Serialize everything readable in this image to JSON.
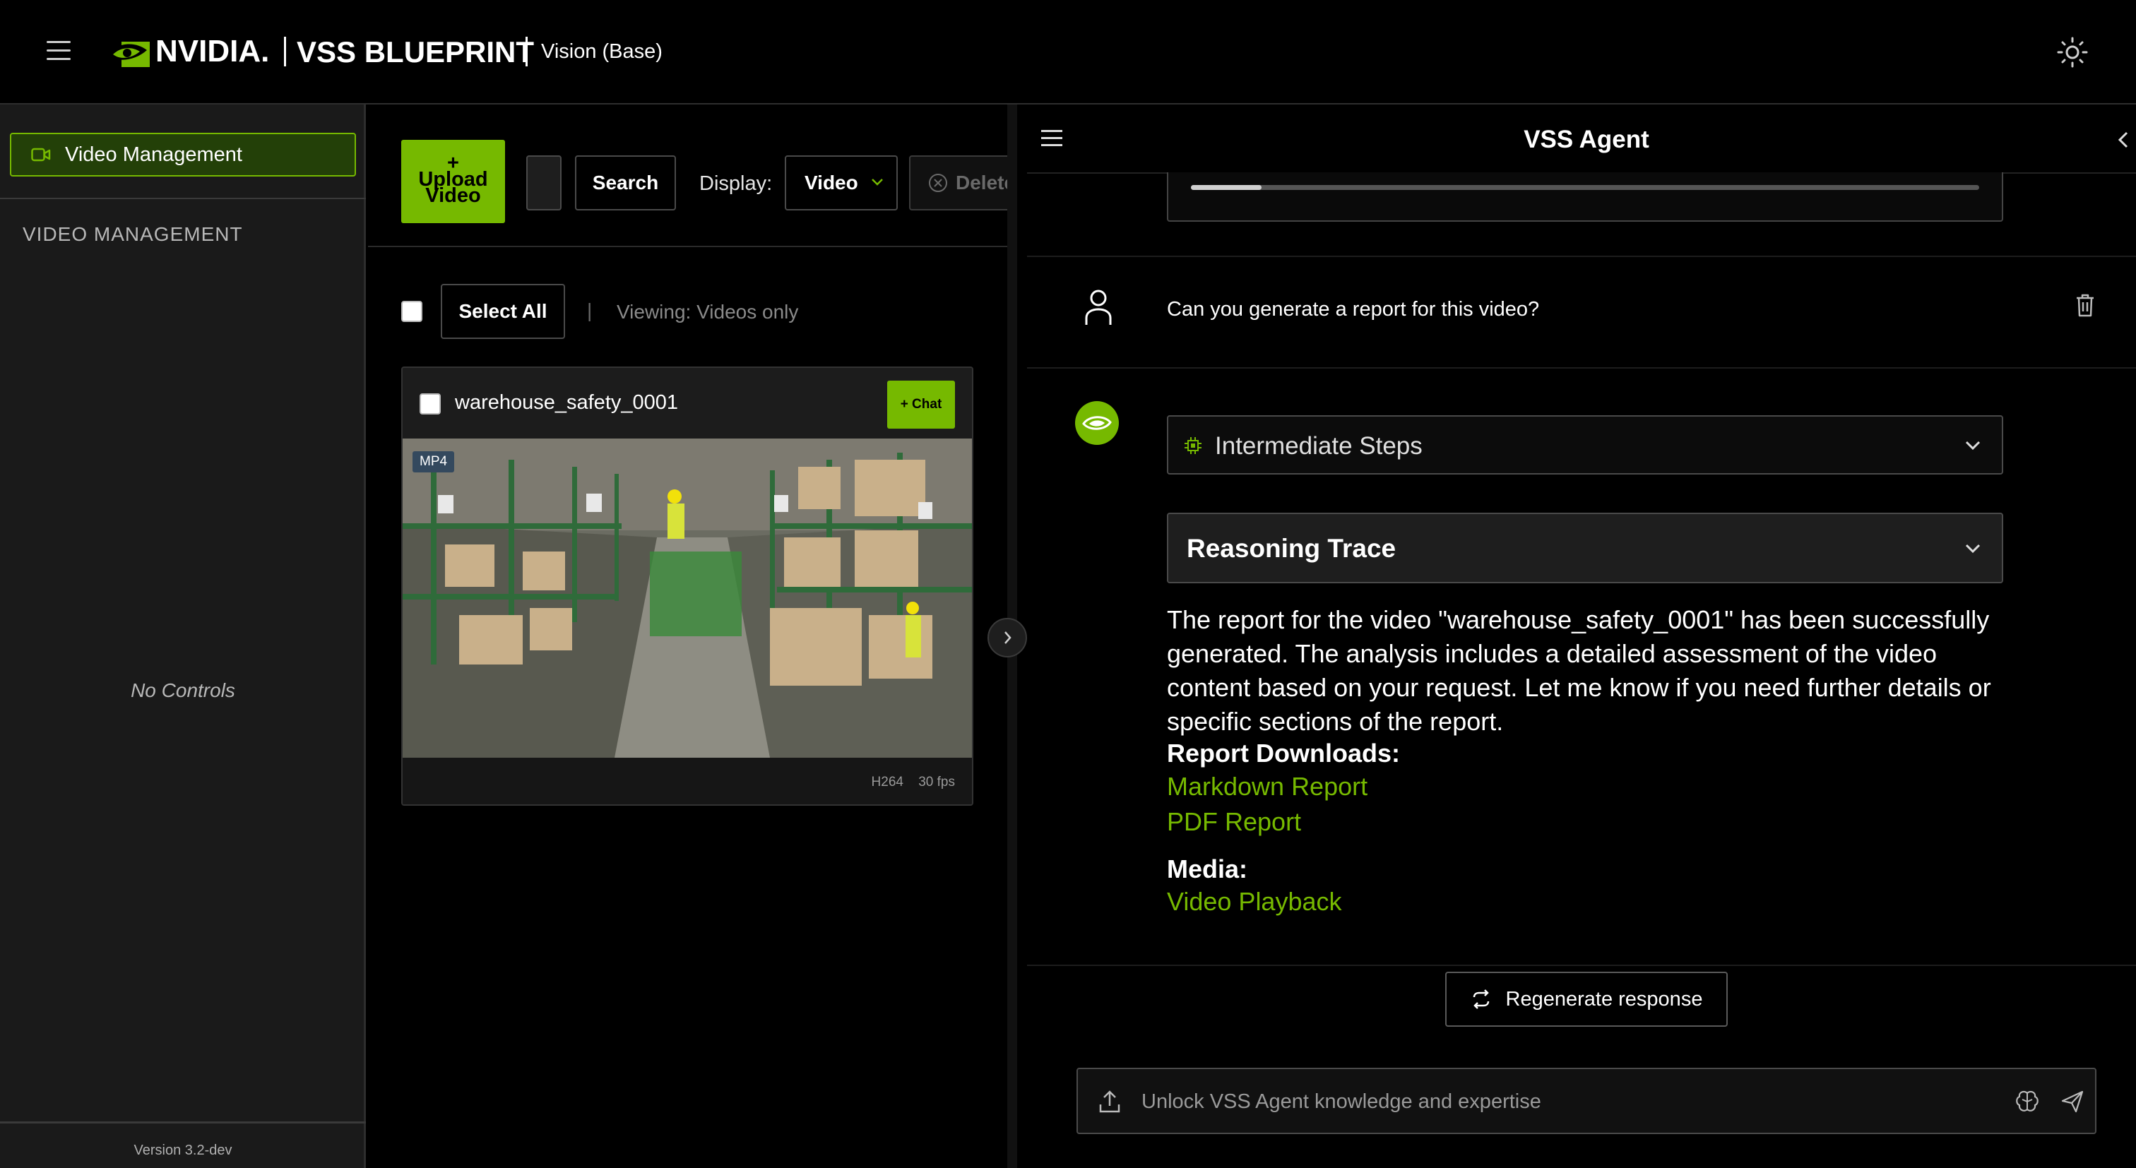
{
  "header": {
    "logo_text": "NVIDIA.",
    "title": "VSS BLUEPRINT",
    "subtitle": "Vision (Base)",
    "menu_icon": "hamburger-icon",
    "theme_icon": "sun-icon"
  },
  "sidebar": {
    "active_item": {
      "label": "Video Management",
      "icon": "video-camera-icon"
    },
    "section_title": "VIDEO MANAGEMENT",
    "empty_text": "No Controls",
    "version": "Version 3.2-dev"
  },
  "video_panel": {
    "upload_label_plus": "+",
    "upload_label_1": "Upload",
    "upload_label_2": "Video",
    "search_label": "Search",
    "search_value": "",
    "display_label": "Display:",
    "display_value": "Video",
    "delete_label": "Delete",
    "select_all_label": "Select All",
    "separator": "|",
    "viewing_text": "Viewing: Videos only",
    "videos": [
      {
        "name": "warehouse_safety_0001",
        "chat_label": "+ Chat",
        "format_badge": "MP4",
        "codec": "H264",
        "fps": "30 fps"
      }
    ]
  },
  "agent": {
    "title": "VSS Agent",
    "progress": 0.09,
    "user_message": "Can you generate a report for this video?",
    "intermediate_steps_label": "Intermediate Steps",
    "reasoning_label": "Reasoning Trace",
    "answer_text": "The report for the video \"warehouse_safety_0001\" has been successfully generated. The analysis includes a detailed assessment of the video content based on your request. Let me know if you need further details or specific sections of the report.",
    "downloads_heading": "Report Downloads:",
    "link_markdown": "Markdown Report",
    "link_pdf": "PDF Report",
    "media_heading": "Media:",
    "link_video": "Video Playback",
    "regenerate_label": "Regenerate response",
    "input_placeholder": "Unlock VSS Agent knowledge and expertise"
  },
  "colors": {
    "accent": "#76b900",
    "background": "#000000",
    "sidebar": "#1a1a1a"
  }
}
